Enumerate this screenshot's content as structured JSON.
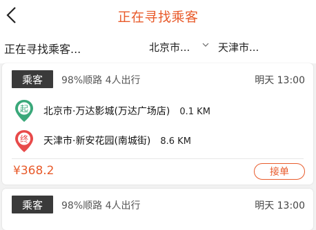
{
  "header": {
    "title": "正在寻找乘客"
  },
  "filter": {
    "status": "正在寻找乘客...",
    "from_city": "北京市...",
    "to_city": "天津市..."
  },
  "colors": {
    "accent": "#e85a2a",
    "start_pin": "#3aa87a",
    "end_pin": "#e84a4a",
    "tag_bg": "#3a3a3a"
  },
  "orders": [
    {
      "tag": "乘客",
      "meta": "98%顺路  4人出行",
      "time": "明天 13:00",
      "from_icon_label": "起",
      "from_address": "北京市·万达影城(万达广场店)",
      "from_distance": "0.1 KM",
      "to_icon_label": "终",
      "to_address": "天津市·新安花园(南城街)",
      "to_distance": "8.6 KM",
      "price": "¥368.2",
      "action": "接单"
    },
    {
      "tag": "乘客",
      "meta": "98%顺路  4人出行",
      "time": "明天 13:00"
    }
  ]
}
